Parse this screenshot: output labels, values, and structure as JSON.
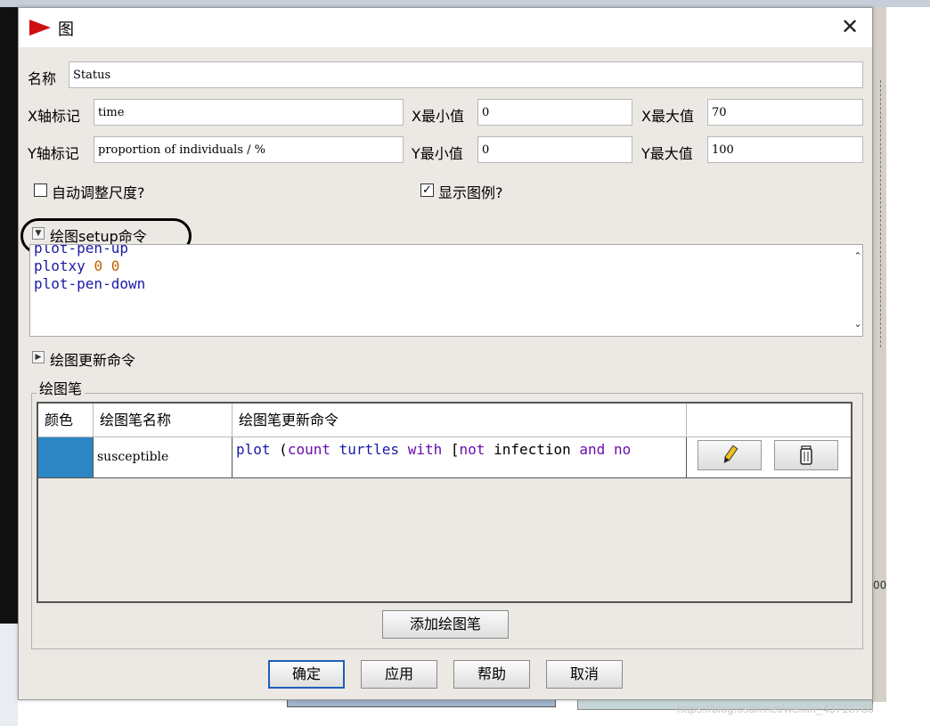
{
  "window": {
    "title": "图"
  },
  "name": {
    "label": "名称",
    "value": "Status"
  },
  "x_axis": {
    "label": "X轴标记",
    "value": "time",
    "min_label": "X最小值",
    "min_value": "0",
    "max_label": "X最大值",
    "max_value": "70"
  },
  "y_axis": {
    "label": "Y轴标记",
    "value": "proportion of individuals / %",
    "min_label": "Y最小值",
    "min_value": "0",
    "max_label": "Y最大值",
    "max_value": "100"
  },
  "options": {
    "autoscale": {
      "label": "自动调整尺度?",
      "checked": false
    },
    "show_legend": {
      "label": "显示图例?",
      "checked": true
    }
  },
  "setup_commands": {
    "label": "绘图setup命令",
    "expanded": true,
    "lines": [
      "plot-pen-up",
      "plotxy 0 0",
      "plot-pen-down"
    ]
  },
  "update_commands": {
    "label": "绘图更新命令",
    "expanded": false
  },
  "pens": {
    "group_label": "绘图笔",
    "columns": [
      "颜色",
      "绘图笔名称",
      "绘图笔更新命令",
      ""
    ],
    "rows": [
      {
        "color": "#2d86c4",
        "name": "susceptible",
        "command": "plot (count turtles with [not infection and no"
      }
    ],
    "add_button": "添加绘图笔",
    "edit_icon": "pencil-icon",
    "delete_icon": "trash-icon"
  },
  "buttons": {
    "ok": "确定",
    "apply": "应用",
    "help": "帮助",
    "cancel": "取消"
  },
  "background": {
    "right_text": "00",
    "watermark": "https://blog.csdn.net/weixin_43718786"
  }
}
